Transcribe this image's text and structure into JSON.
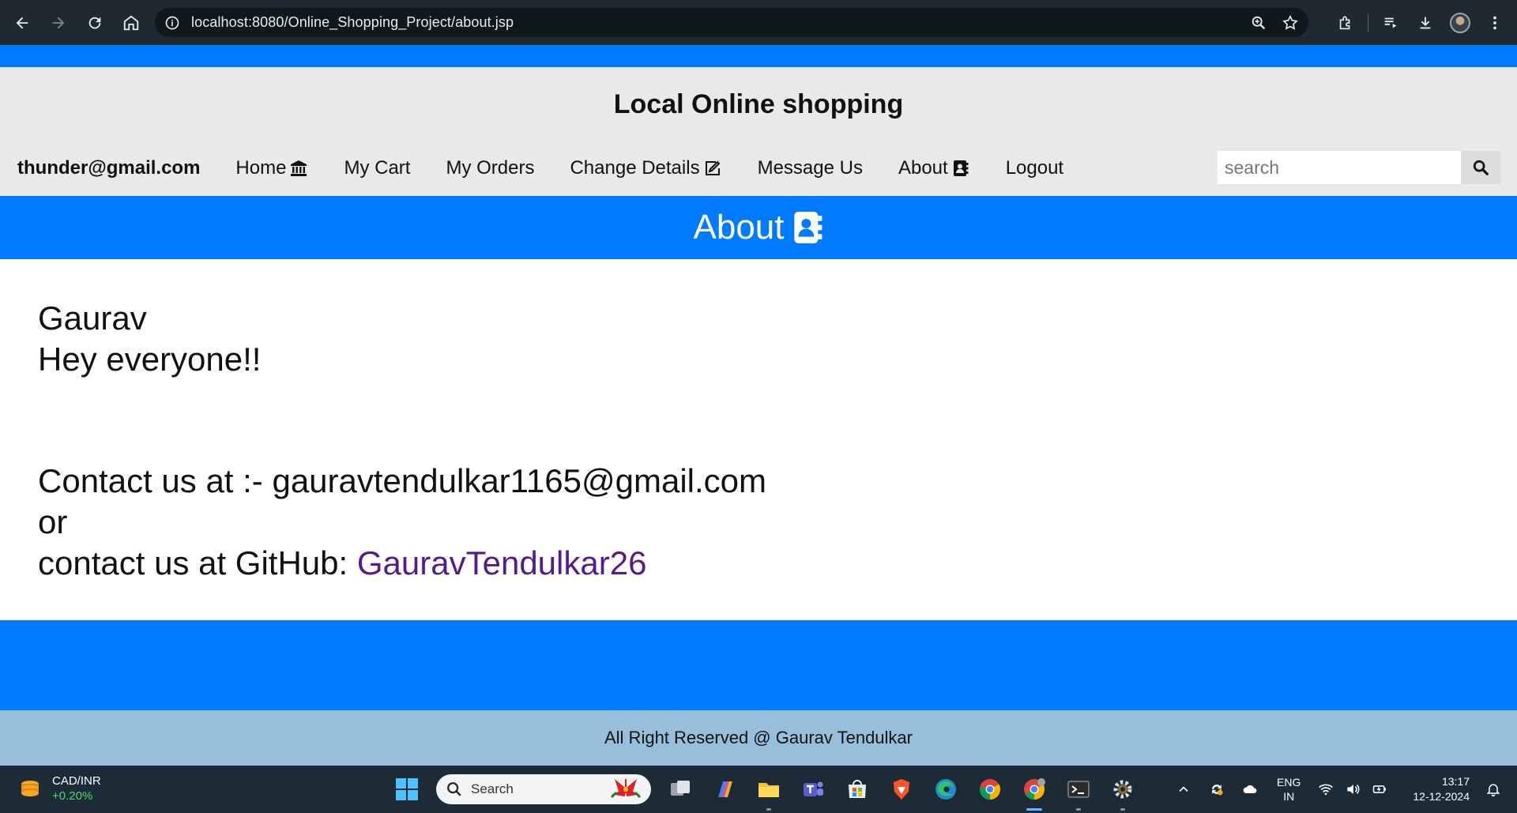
{
  "browser": {
    "url": "localhost:8080/Online_Shopping_Project/about.jsp"
  },
  "site": {
    "title": "Local Online shopping"
  },
  "navbar": {
    "user": "thunder@gmail.com",
    "links": [
      {
        "label": "Home",
        "icon": "bank-icon"
      },
      {
        "label": "My Cart"
      },
      {
        "label": "My Orders"
      },
      {
        "label": "Change Details",
        "icon": "edit-icon"
      },
      {
        "label": "Message Us"
      },
      {
        "label": "About",
        "icon": "address-book-icon"
      },
      {
        "label": "Logout"
      }
    ],
    "search_placeholder": "search"
  },
  "about": {
    "heading": "About",
    "name": "Gaurav",
    "greeting": "Hey everyone!!",
    "contact_line": "Contact us at :- gauravtendulkar1165@gmail.com",
    "or": "or",
    "github_prefix": "contact us at GitHub: ",
    "github_link": "GauravTendulkar26"
  },
  "footer": {
    "text": "All Right Reserved @ Gaurav Tendulkar"
  },
  "taskbar": {
    "widget_title": "CAD/INR",
    "widget_change": "+0.20%",
    "search_label": "Search",
    "lang_top": "ENG",
    "lang_bottom": "IN",
    "time": "13:17",
    "date": "12-12-2024"
  },
  "colors": {
    "brand_blue": "#007bff",
    "header_gray": "#e9e9e9",
    "footer_blue": "#97bfdb",
    "link_purple": "#551a8b"
  }
}
